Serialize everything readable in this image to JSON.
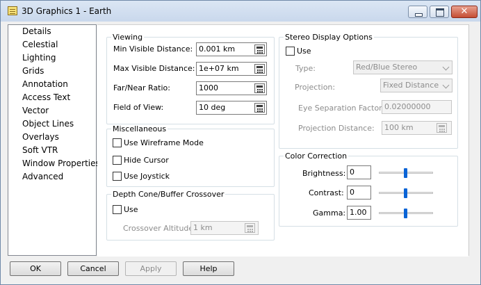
{
  "window": {
    "title": "3D Graphics 1 - Earth",
    "close_glyph": "✕",
    "accent": "#0a64d6"
  },
  "nav": {
    "items": [
      {
        "label": "Details"
      },
      {
        "label": "Celestial"
      },
      {
        "label": "Lighting"
      },
      {
        "label": "Grids"
      },
      {
        "label": "Annotation"
      },
      {
        "label": "Access Text"
      },
      {
        "label": "Vector"
      },
      {
        "label": "Object Lines"
      },
      {
        "label": "Overlays"
      },
      {
        "label": "Soft VTR"
      },
      {
        "label": "Window Properties"
      },
      {
        "label": "Advanced"
      }
    ],
    "selected": "Advanced"
  },
  "viewing": {
    "legend": "Viewing",
    "min_label": "Min Visible Distance:",
    "min_value": "0.001 km",
    "max_label": "Max Visible Distance:",
    "max_value": "1e+07 km",
    "ratio_label": "Far/Near Ratio:",
    "ratio_value": "1000",
    "fov_label": "Field of View:",
    "fov_value": "10 deg"
  },
  "misc": {
    "legend": "Miscellaneous",
    "wireframe": "Use Wireframe Mode",
    "hide_cursor": "Hide Cursor",
    "joystick": "Use Joystick"
  },
  "depth": {
    "legend": "Depth Cone/Buffer Crossover",
    "use": "Use",
    "altitude_label": "Crossover Altitude:",
    "altitude_value": "1 km"
  },
  "stereo": {
    "legend": "Stereo Display Options",
    "use": "Use",
    "type_label": "Type:",
    "type_value": "Red/Blue Stereo",
    "projection_label": "Projection:",
    "projection_value": "Fixed Distance",
    "eye_label": "Eye Separation Factor:",
    "eye_value": "0.02000000",
    "pdist_label": "Projection Distance:",
    "pdist_value": "100 km"
  },
  "color": {
    "legend": "Color Correction",
    "brightness_label": "Brightness:",
    "brightness_value": "0",
    "contrast_label": "Contrast:",
    "contrast_value": "0",
    "gamma_label": "Gamma:",
    "gamma_value": "1.00"
  },
  "buttons": {
    "ok": "OK",
    "cancel": "Cancel",
    "apply": "Apply",
    "help": "Help"
  }
}
